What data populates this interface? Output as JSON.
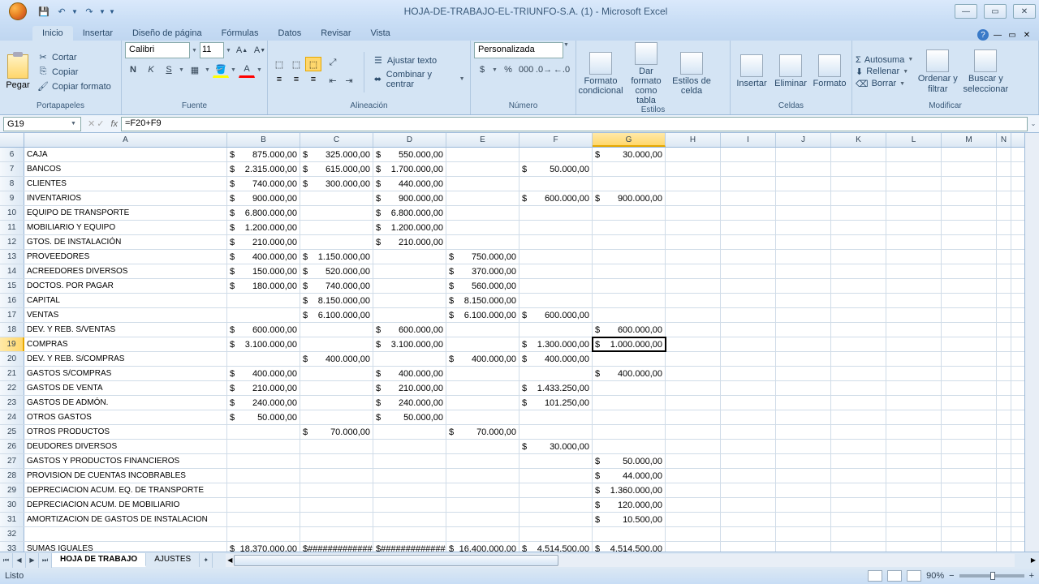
{
  "title": "HOJA-DE-TRABAJO-EL-TRIUNFO-S.A. (1) - Microsoft Excel",
  "tabs": [
    "Inicio",
    "Insertar",
    "Diseño de página",
    "Fórmulas",
    "Datos",
    "Revisar",
    "Vista"
  ],
  "activeTab": 0,
  "ribbon": {
    "paste": "Pegar",
    "cut": "Cortar",
    "copy": "Copiar",
    "fmtpaint": "Copiar formato",
    "clipboard": "Portapapeles",
    "fontName": "Calibri",
    "fontSize": "11",
    "fontGroup": "Fuente",
    "alignGroup": "Alineación",
    "wrap": "Ajustar texto",
    "merge": "Combinar y centrar",
    "numFmt": "Personalizada",
    "numGroup": "Número",
    "condFmt": "Formato condicional",
    "tblFmt": "Dar formato como tabla",
    "cellStyles": "Estilos de celda",
    "styles": "Estilos",
    "insert": "Insertar",
    "delete": "Eliminar",
    "format": "Formato",
    "cells": "Celdas",
    "autosum": "Autosuma",
    "fill": "Rellenar",
    "clear": "Borrar",
    "sort": "Ordenar y filtrar",
    "find": "Buscar y seleccionar",
    "editing": "Modificar"
  },
  "nameBox": "G19",
  "formula": "=F20+F9",
  "columns": [
    "A",
    "B",
    "C",
    "D",
    "E",
    "F",
    "G",
    "H",
    "I",
    "J",
    "K",
    "L",
    "M",
    "N"
  ],
  "colWidths": {
    "A": 250,
    "B": 90,
    "C": 90,
    "D": 90,
    "E": 90,
    "F": 90,
    "G": 90,
    "H": 68,
    "I": 68,
    "J": 68,
    "K": 68,
    "L": 68,
    "M": 68,
    "N": 18
  },
  "selectedCol": "G",
  "selectedRow": 19,
  "rows": [
    {
      "n": 6,
      "A": "CAJA",
      "B": "875.000,00",
      "C": "325.000,00",
      "D": "550.000,00",
      "G": "30.000,00"
    },
    {
      "n": 7,
      "A": "BANCOS",
      "B": "2.315.000,00",
      "C": "615.000,00",
      "D": "1.700.000,00",
      "F": "50.000,00"
    },
    {
      "n": 8,
      "A": "CLIENTES",
      "B": "740.000,00",
      "C": "300.000,00",
      "D": "440.000,00"
    },
    {
      "n": 9,
      "A": "INVENTARIOS",
      "B": "900.000,00",
      "D": "900.000,00",
      "F": "600.000,00",
      "G": "900.000,00"
    },
    {
      "n": 10,
      "A": "EQUIPO DE TRANSPORTE",
      "B": "6.800.000,00",
      "D": "6.800.000,00"
    },
    {
      "n": 11,
      "A": "MOBILIARIO Y EQUIPO",
      "B": "1.200.000,00",
      "D": "1.200.000,00"
    },
    {
      "n": 12,
      "A": "GTOS. DE INSTALACIÓN",
      "B": "210.000,00",
      "D": "210.000,00"
    },
    {
      "n": 13,
      "A": "PROVEEDORES",
      "B": "400.000,00",
      "C": "1.150.000,00",
      "E": "750.000,00"
    },
    {
      "n": 14,
      "A": "ACREEDORES DIVERSOS",
      "B": "150.000,00",
      "C": "520.000,00",
      "E": "370.000,00"
    },
    {
      "n": 15,
      "A": "DOCTOS. POR PAGAR",
      "B": "180.000,00",
      "C": "740.000,00",
      "E": "560.000,00"
    },
    {
      "n": 16,
      "A": "CAPITAL",
      "C": "8.150.000,00",
      "E": "8.150.000,00"
    },
    {
      "n": 17,
      "A": "VENTAS",
      "C": "6.100.000,00",
      "E": "6.100.000,00",
      "F": "600.000,00"
    },
    {
      "n": 18,
      "A": "DEV. Y REB. S/VENTAS",
      "B": "600.000,00",
      "D": "600.000,00",
      "G": "600.000,00"
    },
    {
      "n": 19,
      "A": "COMPRAS",
      "B": "3.100.000,00",
      "D": "3.100.000,00",
      "F": "1.300.000,00",
      "G": "1.000.000,00",
      "selected": true
    },
    {
      "n": 20,
      "A": "DEV. Y REB. S/COMPRAS",
      "C": "400.000,00",
      "E": "400.000,00",
      "F": "400.000,00"
    },
    {
      "n": 21,
      "A": "GASTOS S/COMPRAS",
      "B": "400.000,00",
      "D": "400.000,00",
      "G": "400.000,00"
    },
    {
      "n": 22,
      "A": "GASTOS DE VENTA",
      "B": "210.000,00",
      "D": "210.000,00",
      "F": "1.433.250,00"
    },
    {
      "n": 23,
      "A": "GASTOS DE ADMÓN.",
      "B": "240.000,00",
      "D": "240.000,00",
      "F": "101.250,00"
    },
    {
      "n": 24,
      "A": "OTROS GASTOS",
      "B": "50.000,00",
      "D": "50.000,00"
    },
    {
      "n": 25,
      "A": "OTROS PRODUCTOS",
      "C": "70.000,00",
      "E": "70.000,00"
    },
    {
      "n": 26,
      "A": "DEUDORES DIVERSOS",
      "F": "30.000,00"
    },
    {
      "n": 27,
      "A": "GASTOS Y PRODUCTOS FINANCIEROS",
      "G": "50.000,00"
    },
    {
      "n": 28,
      "A": "PROVISION DE CUENTAS INCOBRABLES",
      "G": "44.000,00"
    },
    {
      "n": 29,
      "A": "DEPRECIACION ACUM. EQ. DE TRANSPORTE",
      "G": "1.360.000,00"
    },
    {
      "n": 30,
      "A": "DEPRECIACION ACUM. DE MOBILIARIO",
      "G": "120.000,00"
    },
    {
      "n": 31,
      "A": "AMORTIZACION DE GASTOS DE INSTALACION",
      "G": "10.500,00"
    },
    {
      "n": 32,
      "A": ""
    },
    {
      "n": 33,
      "A": "SUMAS IGUALES",
      "B": "18.370.000,00",
      "C": "#############",
      "D": "#############",
      "E": "16.400.000,00",
      "F": "4.514.500,00",
      "G": "4.514.500,00"
    }
  ],
  "sheetTabs": [
    "HOJA DE TRABAJO",
    "AJUSTES"
  ],
  "activeSheet": 0,
  "status": "Listo",
  "zoom": "90%"
}
